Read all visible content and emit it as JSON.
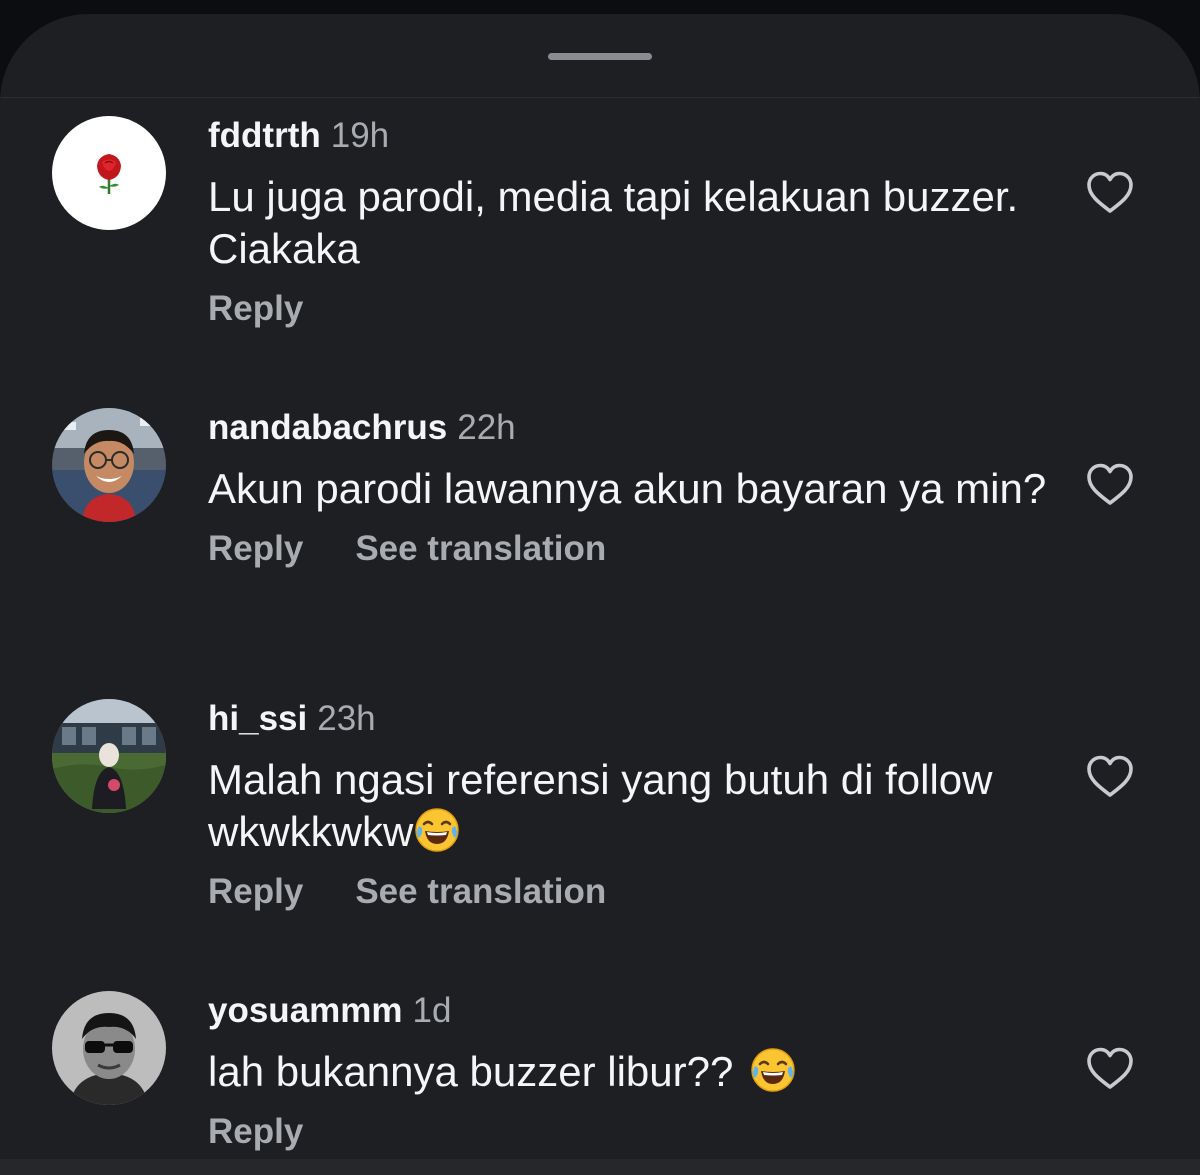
{
  "comments": [
    {
      "username": "fddtrth",
      "time": "19h",
      "text": "Lu juga parodi, media tapi kelakuan buzzer. Ciakaka",
      "reply_label": "Reply",
      "translate_label": ""
    },
    {
      "username": "nandabachrus",
      "time": "22h",
      "text": "Akun parodi lawannya akun bayaran ya min?",
      "reply_label": "Reply",
      "translate_label": "See translation"
    },
    {
      "username": "hi_ssi",
      "time": "23h",
      "text": "Malah ngasi referensi yang butuh di follow wkwkkwkw",
      "reply_label": "Reply",
      "translate_label": "See translation"
    },
    {
      "username": "yosuammm",
      "time": "1d",
      "text": "lah bukannya buzzer libur??",
      "reply_label": "Reply",
      "translate_label": ""
    }
  ],
  "icons": {
    "like": "heart-outline-icon",
    "emoji": "face-with-tears-of-joy-icon"
  },
  "colors": {
    "background": "#1e1f22",
    "text_primary": "#f3f5f7",
    "text_secondary": "#a8abb0"
  }
}
